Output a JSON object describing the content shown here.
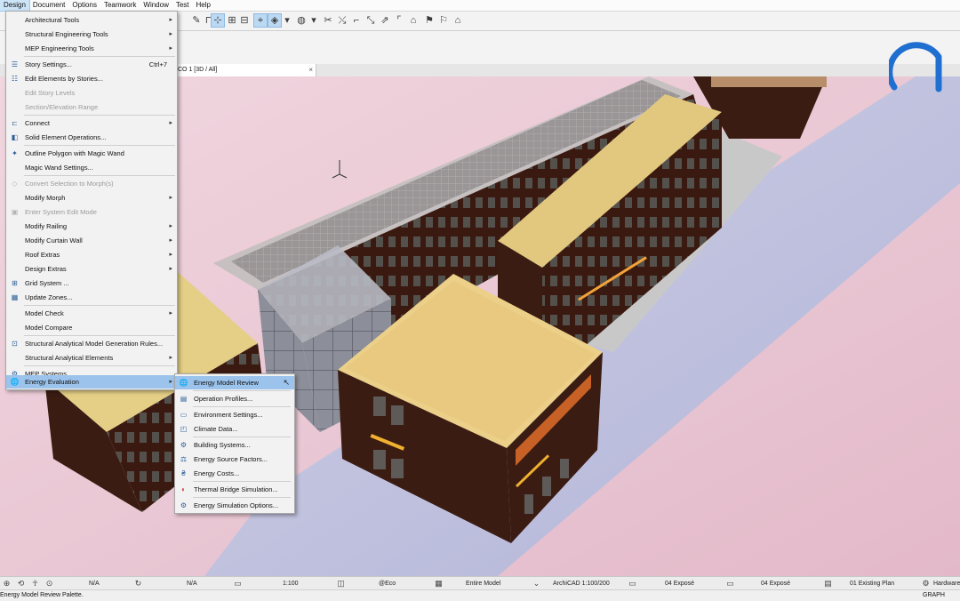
{
  "menubar": {
    "items": [
      "Design",
      "Document",
      "Options",
      "Teamwork",
      "Window",
      "Test",
      "Help"
    ],
    "active_index": 0
  },
  "tab": {
    "title": "CO 1 [3D / All]",
    "close": "×"
  },
  "design_menu": {
    "items": [
      {
        "label": "Architectural Tools",
        "icon": "",
        "submenu": true
      },
      {
        "label": "Structural Engineering Tools",
        "icon": "",
        "submenu": true
      },
      {
        "label": "MEP Engineering Tools",
        "icon": "",
        "submenu": true
      },
      {
        "label": "Story Settings...",
        "icon": "story-settings-icon",
        "shortcut": "Ctrl+7"
      },
      {
        "label": "Edit Elements by Stories...",
        "icon": "stories-icon"
      },
      {
        "label": "Edit Story Levels",
        "icon": "",
        "disabled": true
      },
      {
        "label": "Section/Elevation Range",
        "icon": "",
        "disabled": true
      },
      {
        "label": "Connect",
        "icon": "connect-icon",
        "submenu": true
      },
      {
        "label": "Solid Element Operations...",
        "icon": "solid-ops-icon"
      },
      {
        "label": "Outline Polygon with Magic Wand",
        "icon": "magic-wand-icon"
      },
      {
        "label": "Magic Wand Settings...",
        "icon": ""
      },
      {
        "label": "Convert Selection to Morph(s)",
        "icon": "morph-icon",
        "disabled": true
      },
      {
        "label": "Modify Morph",
        "icon": "",
        "submenu": true
      },
      {
        "label": "Enter System Edit Mode",
        "icon": "system-edit-icon",
        "disabled": true
      },
      {
        "label": "Modify Railing",
        "icon": "",
        "submenu": true
      },
      {
        "label": "Modify Curtain Wall",
        "icon": "",
        "submenu": true
      },
      {
        "label": "Roof Extras",
        "icon": "",
        "submenu": true
      },
      {
        "label": "Design Extras",
        "icon": "",
        "submenu": true
      },
      {
        "label": "Grid System ...",
        "icon": "grid-icon"
      },
      {
        "label": "Update Zones...",
        "icon": "zones-icon"
      },
      {
        "label": "Model Check",
        "icon": "",
        "submenu": true
      },
      {
        "label": "Model Compare",
        "icon": ""
      },
      {
        "label": "Structural Analytical Model Generation Rules...",
        "icon": "structural-rules-icon"
      },
      {
        "label": "Structural Analytical Elements",
        "icon": "",
        "submenu": true
      },
      {
        "label": "MEP Systems...",
        "icon": "mep-icon"
      },
      {
        "label": "Energy Evaluation",
        "icon": "globe-icon",
        "submenu": true,
        "highlighted": true
      }
    ]
  },
  "energy_menu": {
    "items": [
      {
        "label": "Energy Model Review",
        "icon": "globe-icon",
        "highlighted": true
      },
      {
        "label": "Operation Profiles...",
        "icon": "profiles-icon"
      },
      {
        "label": "Environment Settings...",
        "icon": "environment-icon"
      },
      {
        "label": "Climate Data...",
        "icon": "climate-icon"
      },
      {
        "label": "Building Systems...",
        "icon": "building-systems-icon"
      },
      {
        "label": "Energy Source Factors...",
        "icon": "source-factors-icon"
      },
      {
        "label": "Energy Costs...",
        "icon": "energy-costs-icon"
      },
      {
        "label": "Thermal Bridge Simulation...",
        "icon": "thermal-bridge-icon"
      },
      {
        "label": "Energy Simulation Options...",
        "icon": "simulation-options-icon"
      }
    ]
  },
  "statusbar": {
    "na1": "N/A",
    "na2": "N/A",
    "scale": "1:100",
    "pen_set": "@Eco",
    "model_view": "Entire Model",
    "layer_combo": "ArchiCAD 1:100/200",
    "expose1": "04 Exposé",
    "expose2": "04 Exposé",
    "renovation": "01 Existing Plan",
    "hardware": "Hardware",
    "graph": "GRAPH"
  },
  "message": "Energy Model Review Palette.",
  "colors": {
    "sky": "#e8c7d4",
    "highlight": "#9bc3ec",
    "roof_tan": "#e5cf86",
    "wall_brown": "#3b1c12",
    "logo_blue": "#1f6fd1"
  }
}
